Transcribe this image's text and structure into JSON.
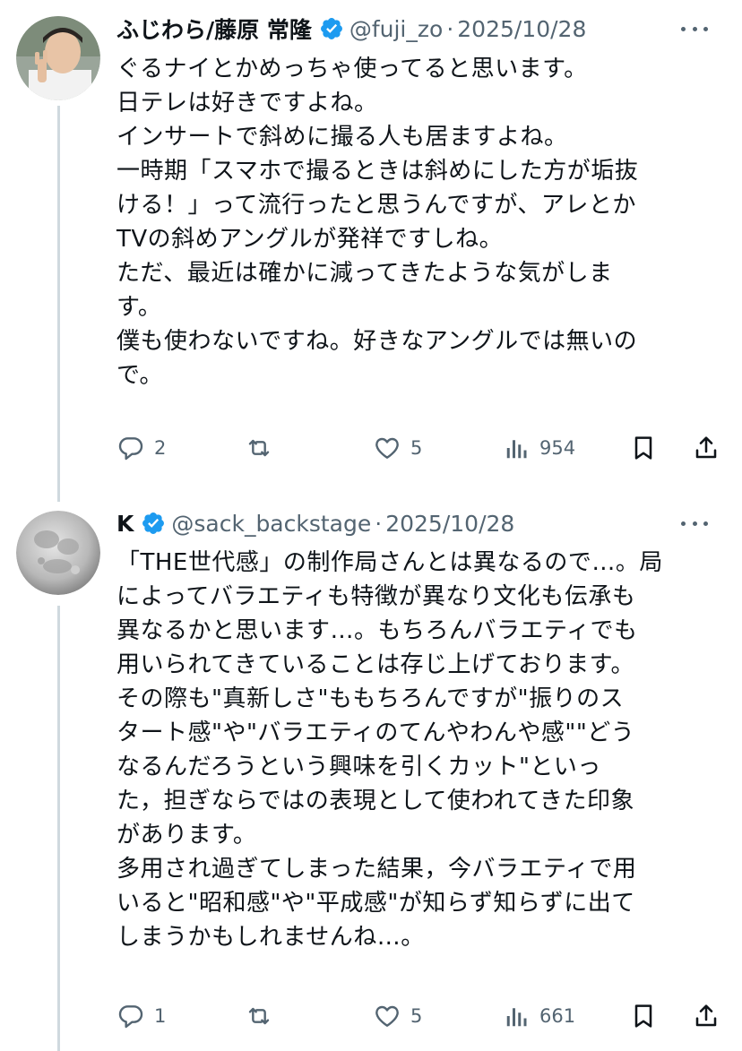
{
  "tweets": [
    {
      "name": "ふじわら/藤原 常隆",
      "handle": "@fuji_zo",
      "separator": "·",
      "date": "2025/10/28",
      "lines": [
        "ぐるナイとかめっちゃ使ってると思います。",
        "日テレは好きですよね。",
        "インサートで斜めに撮る人も居ますよね。",
        "一時期「スマホで撮るときは斜めにした方が垢抜",
        "ける！」って流行ったと思うんですが、アレとか",
        "TVの斜めアングルが発祥ですしね。",
        "ただ、最近は確かに減ってきたような気がしま",
        "す。",
        "僕も使わないですね。好きなアングルでは無いの",
        "で。"
      ],
      "replies": "2",
      "retweets": "",
      "likes": "5",
      "views": "954"
    },
    {
      "name": "K",
      "handle": "@sack_backstage",
      "separator": "·",
      "date": "2025/10/28",
      "lines": [
        "「THE世代感」の制作局さんとは異なるので…。局",
        "によってバラエティも特徴が異なり文化も伝承も",
        "異なるかと思います…。もちろんバラエティでも",
        "用いられてきていることは存じ上げております。",
        "その際も\"真新しさ\"ももちろんですが\"振りのス",
        "タート感\"や\"バラエティのてんやわんや感\"\"どう",
        "なるんだろうという興味を引くカット\"といっ",
        "た，担ぎならではの表現として使われてきた印象",
        "があります。",
        "多用され過ぎてしまった結果，今バラエティで用",
        "いると\"昭和感\"や\"平成感\"が知らず知らずに出て",
        "しまうかもしれませんね…。"
      ],
      "replies": "1",
      "retweets": "",
      "likes": "5",
      "views": "661"
    }
  ],
  "icons": {
    "verified": "verified-badge-icon",
    "more": "more-dots-icon",
    "reply": "reply-icon",
    "retweet": "retweet-icon",
    "like": "heart-icon",
    "views": "views-chart-icon",
    "bookmark": "bookmark-icon",
    "share": "share-icon"
  },
  "colors": {
    "verified": "#1d9bf0",
    "secondary_text": "#536471",
    "text": "#0f1419",
    "thread_line": "#cfd9de"
  }
}
